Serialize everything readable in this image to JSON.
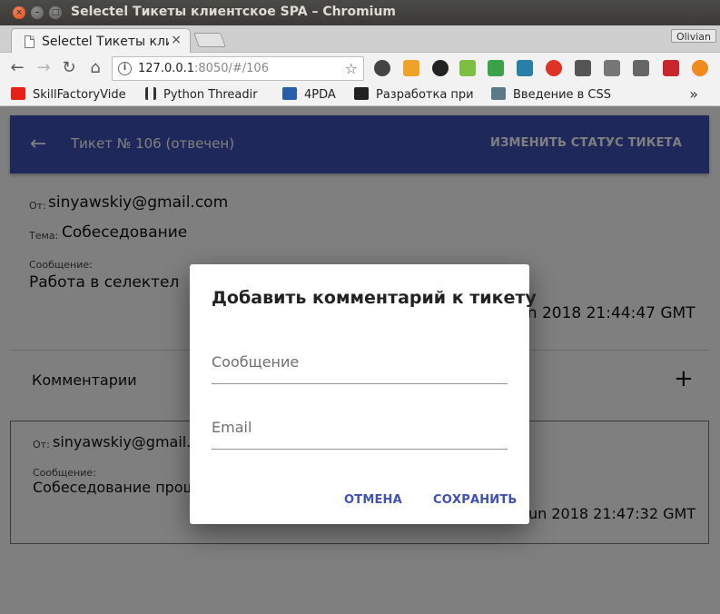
{
  "window": {
    "title": "Selectel Тикеты клиентское SPA – Chromium",
    "close": "×",
    "minimize": "–",
    "maximize": "□"
  },
  "tabs": [
    {
      "label": "Selectel Тикеты кли",
      "close": "×"
    }
  ],
  "profile": {
    "name": "Olivian"
  },
  "toolbar": {
    "back": "←",
    "forward": "→",
    "reload": "↻",
    "home": "⌂",
    "info": "i",
    "url_host": "127.0.0.1",
    "url_rest": ":8050/#/106",
    "star": "☆"
  },
  "extensions": [
    {
      "name": "radio-icon",
      "color": "#444444"
    },
    {
      "name": "alert-icon",
      "color": "#f0a12a"
    },
    {
      "name": "paw-icon",
      "color": "#222222"
    },
    {
      "name": "green-ext-icon",
      "color": "#7cc043"
    },
    {
      "name": "new-ext-icon",
      "color": "#3aa34a"
    },
    {
      "name": "triangle-icon",
      "color": "#2a7fa8"
    },
    {
      "name": "opera-icon",
      "color": "#e03327"
    },
    {
      "name": "zero-one-icon",
      "color": "#555555"
    },
    {
      "name": "gear-icon",
      "color": "#777777"
    },
    {
      "name": "code-icon",
      "color": "#666666"
    },
    {
      "name": "red-grid-icon",
      "color": "#c8262d"
    },
    {
      "name": "warning-icon",
      "color": "#f08a1c"
    }
  ],
  "bookmarks": [
    {
      "label": "SkillFactoryVide",
      "icon": "youtube-icon",
      "color": "#e62117"
    },
    {
      "label": "Python Threadir",
      "icon": "bars-icon",
      "color": "#333333"
    },
    {
      "label": "4PDA",
      "icon": "fourpda-icon",
      "color": "#2b5ea8"
    },
    {
      "label": "Разработка при",
      "icon": "hab-icon",
      "color": "#222222"
    },
    {
      "label": "Введение в CSS",
      "icon": "h-icon",
      "color": "#5a7a8a"
    }
  ],
  "bookmarks_more": "»",
  "appbar": {
    "back": "←",
    "title": "Тикет № 106 (отвечен)",
    "action": "ИЗМЕНИТЬ СТАТУС ТИКЕТА"
  },
  "ticket": {
    "from_label": "От:",
    "from": "sinyawskiy@gmail.com",
    "subject_label": "Тема:",
    "subject": "Собеседование",
    "message_label": "Сообщение:",
    "message": "Работа в селектел",
    "date": "un 2018 21:44:47 GMT"
  },
  "comments": {
    "title": "Комментарии",
    "add": "+",
    "items": [
      {
        "from_label": "От:",
        "from": "sinyawskiy@gmail.c",
        "message_label": "Сообщение:",
        "message": "Собеседование прош",
        "date": "un 2018 21:47:32 GMT"
      }
    ]
  },
  "dialog": {
    "title": "Добавить комментарий к тикету",
    "message_placeholder": "Сообщение",
    "email_placeholder": "Email",
    "cancel": "ОТМЕНА",
    "save": "СОХРАНИТЬ"
  }
}
